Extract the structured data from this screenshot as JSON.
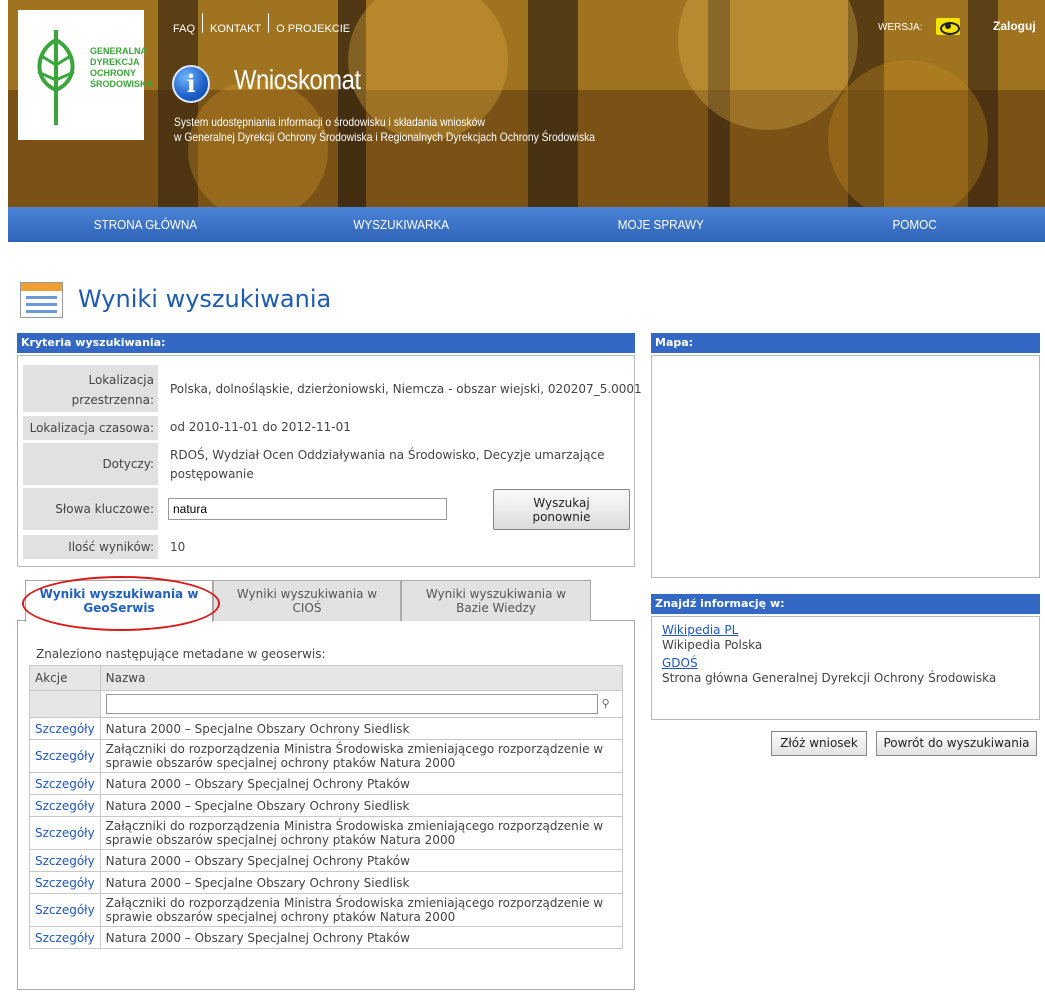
{
  "header": {
    "logo_text": "GENERALNA DYREKCJA OCHRONY ŚRODOWISKA",
    "top_links": [
      "FAQ",
      "KONTAKT",
      "O PROJEKCIE"
    ],
    "app_title": "Wnioskomat",
    "subtitle_line1": "System udostępniania informacji o środowisku i składania wniosków",
    "subtitle_line2": "w Generalnej Dyrekcji Ochrony Środowiska i Regionalnych Dyrekcjach Ochrony Środowiska",
    "version_label": "WERSJA:",
    "login": "Zaloguj"
  },
  "nav": [
    "STRONA GŁÓWNA",
    "WYSZUKIWARKA",
    "MOJE SPRAWY",
    "POMOC"
  ],
  "page_title": "Wyniki wyszukiwania",
  "criteria": {
    "header": "Kryteria wyszukiwania:",
    "rows": [
      {
        "label": "Lokalizacja przestrzenna:",
        "value": "Polska, dolnośląskie, dzierżoniowski, Niemcza - obszar wiejski, 020207_5.0001"
      },
      {
        "label": "Lokalizacja czasowa:",
        "value": "od 2010-11-01 do 2012-11-01"
      },
      {
        "label": "Dotyczy:",
        "value": "RDOŚ, Wydział Ocen Oddziaływania na Środowisko, Decyzje umarzające postępowanie"
      },
      {
        "label": "Słowa kluczowe:",
        "value": "natura"
      },
      {
        "label": "Ilość wyników:",
        "value": "10"
      }
    ],
    "search_again": "Wyszukaj ponownie"
  },
  "tabs": [
    {
      "label": "Wyniki wyszukiwania w GeoSerwis",
      "active": true
    },
    {
      "label": "Wyniki wyszukiwania w CIOŚ",
      "active": false
    },
    {
      "label": "Wyniki wyszukiwania w Bazie Wiedzy",
      "active": false
    }
  ],
  "results": {
    "found_text": "Znaleziono następujące metadane w geoserwis:",
    "columns": [
      "Akcje",
      "Nazwa"
    ],
    "action_label": "Szczegóły",
    "rows": [
      "Natura 2000 – Specjalne Obszary Ochrony Siedlisk",
      "Załączniki do rozporządzenia Ministra Środowiska zmieniającego rozporządzenie w sprawie obszarów specjalnej ochrony ptaków Natura 2000",
      "Natura 2000 – Obszary Specjalnej Ochrony Ptaków",
      "Natura 2000 – Specjalne Obszary Ochrony Siedlisk",
      "Załączniki do rozporządzenia Ministra Środowiska zmieniającego rozporządzenie w sprawie obszarów specjalnej ochrony ptaków Natura 2000",
      "Natura 2000 – Obszary Specjalnej Ochrony Ptaków",
      "Natura 2000 – Specjalne Obszary Ochrony Siedlisk",
      "Załączniki do rozporządzenia Ministra Środowiska zmieniającego rozporządzenie w sprawie obszarów specjalnej ochrony ptaków Natura 2000",
      "Natura 2000 – Obszary Specjalnej Ochrony Ptaków"
    ]
  },
  "map": {
    "header": "Mapa:"
  },
  "info": {
    "header": "Znajdź informację w:",
    "links": [
      {
        "label": "Wikipedia PL",
        "desc": "Wikipedia Polska"
      },
      {
        "label": "GDOŚ",
        "desc": "Strona główna Generalnej Dyrekcji Ochrony Środowiska"
      }
    ]
  },
  "buttons": {
    "submit": "Złóż wniosek",
    "back": "Powrót do wyszukiwania"
  },
  "colors": {
    "nav": "#3369c4",
    "link": "#1f56c0",
    "highlight_circle": "#d91a1a"
  }
}
